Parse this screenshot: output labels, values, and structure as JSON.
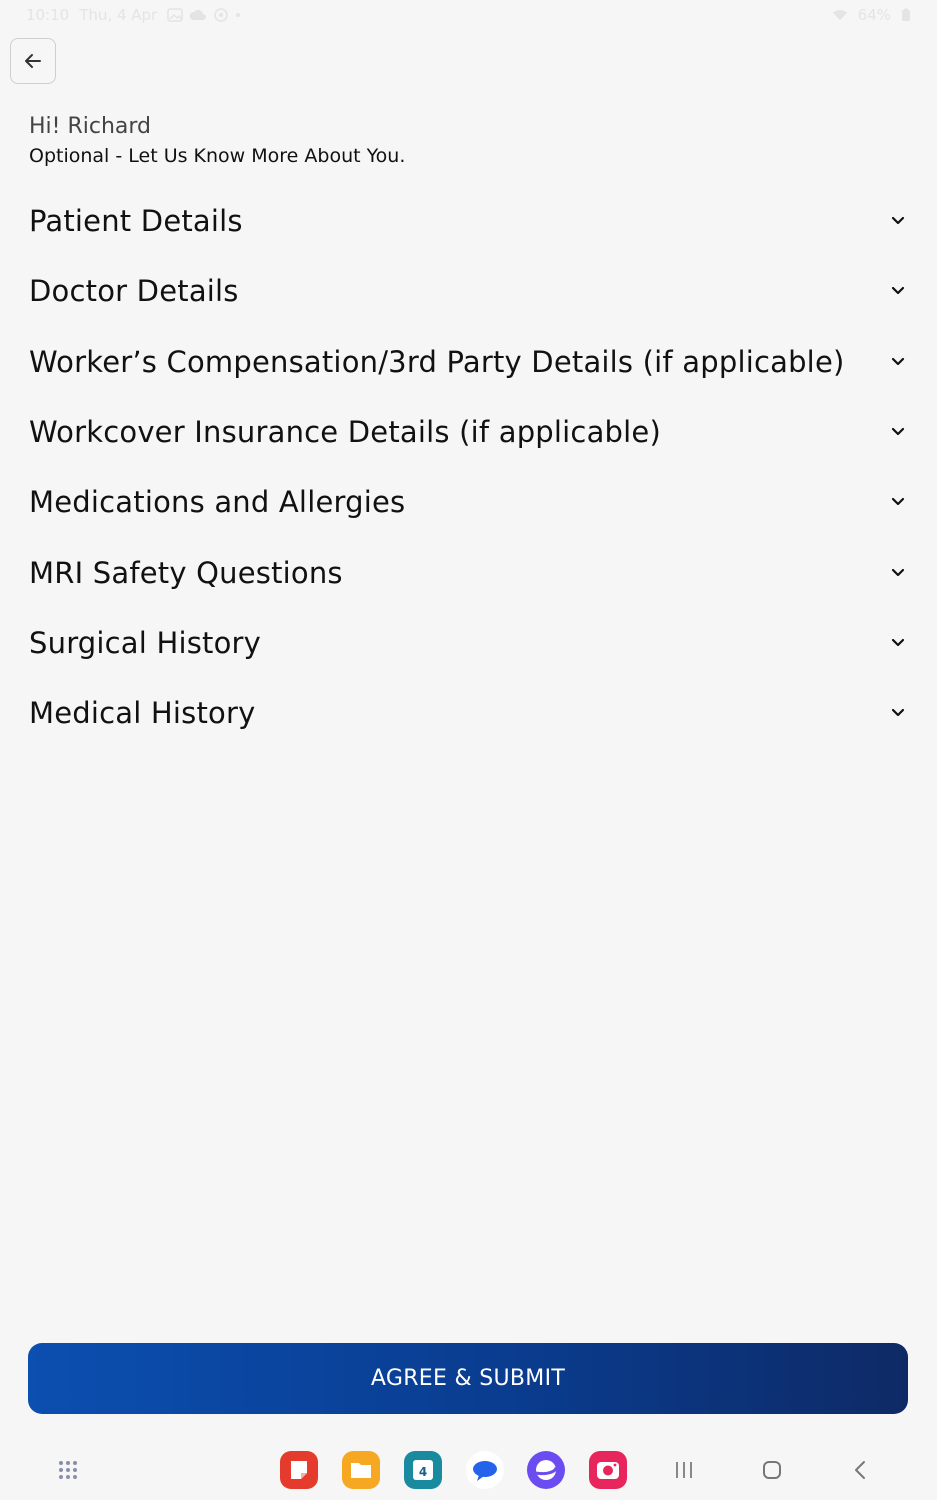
{
  "status_bar": {
    "time": "10:10",
    "date": "Thu, 4 Apr",
    "battery": "64%"
  },
  "greeting": "Hi! Richard",
  "subtitle": "Optional - Let Us Know More About You.",
  "sections": [
    {
      "label": "Patient Details"
    },
    {
      "label": "Doctor Details"
    },
    {
      "label": "Worker’s Compensation/3rd Party Details (if applicable)"
    },
    {
      "label": "Workcover Insurance Details (if applicable)"
    },
    {
      "label": "Medications and Allergies"
    },
    {
      "label": "MRI Safety Questions"
    },
    {
      "label": "Surgical History"
    },
    {
      "label": "Medical History"
    }
  ],
  "submit_label": "AGREE & SUBMIT",
  "calendar_day": "4",
  "colors": {
    "background": "#f6f6f6",
    "button_start": "#0b4fb0",
    "button_end": "#0e2a66"
  }
}
